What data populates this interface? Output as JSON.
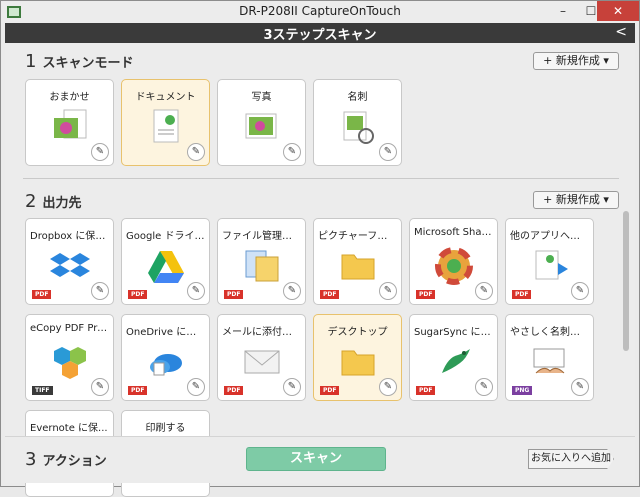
{
  "window": {
    "title": "DR-P208II CaptureOnTouch"
  },
  "header": {
    "title": "3ステップスキャン",
    "back_symbol": "<"
  },
  "section1": {
    "number": "1",
    "title": "スキャンモード",
    "new_button": "+ 新規作成 ▾"
  },
  "modes": [
    {
      "label": "おまかせ",
      "icon": "photo-document-icon"
    },
    {
      "label": "ドキュメント",
      "icon": "document-icon"
    },
    {
      "label": "写真",
      "icon": "photo-icon"
    },
    {
      "label": "名刺",
      "icon": "business-card-icon"
    }
  ],
  "section2": {
    "number": "2",
    "title": "出力先",
    "new_button": "+ 新規作成 ▾"
  },
  "destinations": [
    {
      "label": "Dropbox に保存...",
      "badge": "PDF",
      "icon": "dropbox-icon"
    },
    {
      "label": "Google ドライブ...",
      "badge": "PDF",
      "icon": "google-drive-icon"
    },
    {
      "label": "ファイル管理革命L...",
      "badge": "PDF",
      "icon": "file-manager-icon"
    },
    {
      "label": "ピクチャーフォルダー",
      "badge": "PDF",
      "icon": "folder-icon"
    },
    {
      "label": "Microsoft Shar...",
      "badge": "PDF",
      "icon": "sharepoint-icon"
    },
    {
      "label": "他のアプリへ送る",
      "badge": "PDF",
      "icon": "send-to-app-icon"
    },
    {
      "label": "eCopy PDF Pro...",
      "badge": "TIFF",
      "icon": "ecopy-icon"
    },
    {
      "label": "OneDrive に保...",
      "badge": "PDF",
      "icon": "onedrive-icon"
    },
    {
      "label": "メールに添付する",
      "badge": "PDF",
      "icon": "mail-icon"
    },
    {
      "label": "デスクトップ",
      "badge": "PDF",
      "icon": "desktop-folder-icon"
    },
    {
      "label": "SugarSync に保...",
      "badge": "PDF",
      "icon": "sugarsync-icon"
    },
    {
      "label": "やさしく名刺ファイ...",
      "badge": "PNG",
      "icon": "namecard-file-icon"
    },
    {
      "label": "Evernote に保...",
      "badge": "",
      "icon": "evernote-icon"
    },
    {
      "label": "印刷する",
      "badge": "",
      "icon": "printer-icon"
    }
  ],
  "section3": {
    "number": "3",
    "title": "アクション"
  },
  "actions": {
    "scan": "スキャン",
    "favorite": "お気に入りへ追加"
  },
  "colors": {
    "accent": "#7ecba6",
    "selected": "#fdf4df",
    "pdf": "#d8322a",
    "header": "#3a3a3a"
  }
}
